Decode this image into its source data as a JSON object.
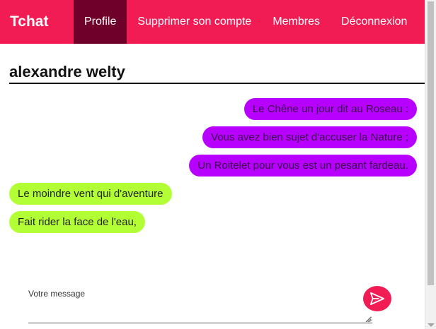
{
  "navbar": {
    "brand": "Tchat",
    "items": [
      {
        "label": "Profile",
        "active": true
      },
      {
        "label": "Supprimer son compte",
        "active": false
      },
      {
        "label": "Membres",
        "active": false
      },
      {
        "label": "Déconnexion",
        "active": false
      }
    ]
  },
  "conversation": {
    "title": "alexandre welty",
    "messages": [
      {
        "text": "Le Chêne un jour dit au Roseau :",
        "direction": "sent"
      },
      {
        "text": "Vous avez bien sujet d'accuser la Nature ;",
        "direction": "sent"
      },
      {
        "text": "Un Roitelet pour vous est un pesant fardeau.",
        "direction": "sent"
      },
      {
        "text": "Le moindre vent qui d'aventure",
        "direction": "received"
      },
      {
        "text": "Fait rider la face de l'eau,",
        "direction": "received"
      }
    ]
  },
  "composer": {
    "label": "Votre message",
    "value": ""
  },
  "colors": {
    "primary": "#f21c55",
    "active_nav": "#6e0029",
    "sent_bubble": "#b700ff",
    "received_bubble": "#b3ff35"
  },
  "icons": {
    "send": "send-icon"
  }
}
